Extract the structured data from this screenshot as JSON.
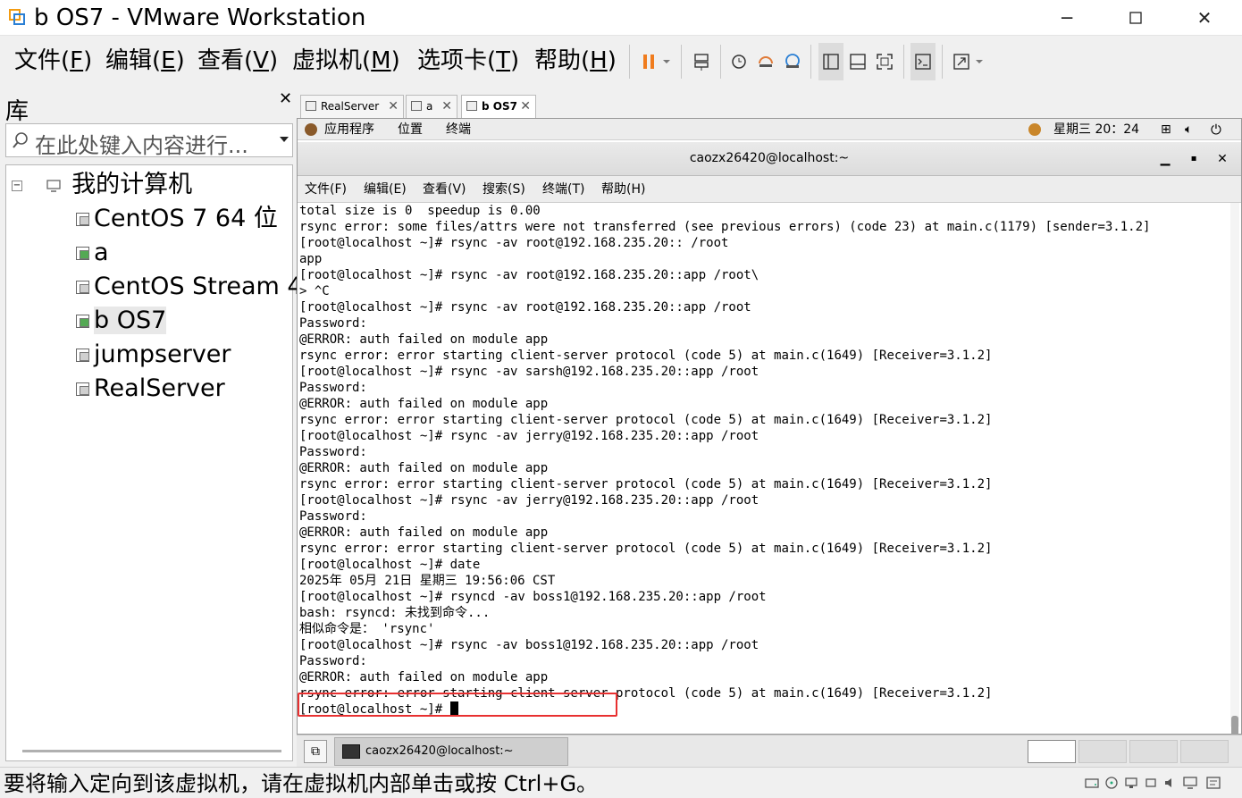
{
  "window": {
    "title": "b OS7 - VMware Workstation"
  },
  "menu": {
    "file": "文件(",
    "file_key": "F",
    "file_end": ")",
    "edit": "编辑(",
    "edit_key": "E",
    "edit_end": ")",
    "view": "查看(",
    "view_key": "V",
    "view_end": ")",
    "vm": "虚拟机(",
    "vm_key": "M",
    "vm_end": ")",
    "tabs": "选项卡(",
    "tabs_key": "T",
    "tabs_end": ")",
    "help": "帮助(",
    "help_key": "H",
    "help_end": ")"
  },
  "library": {
    "title": "库",
    "search_placeholder": "在此处键入内容进行...",
    "root": "我的计算机",
    "items": [
      "CentOS 7 64 位",
      "a",
      "CentOS Stream 4",
      "b OS7",
      "jumpserver",
      "RealServer"
    ]
  },
  "tabs": [
    {
      "label": "RealServer"
    },
    {
      "label": "a"
    },
    {
      "label": "b OS7"
    }
  ],
  "gnome": {
    "applications": "应用程序",
    "places": "位置",
    "terminal": "终端",
    "clock": "星期三 20：24"
  },
  "terminal": {
    "title": "caozx26420@localhost:~",
    "menu": [
      "文件(F)",
      "编辑(E)",
      "查看(V)",
      "搜索(S)",
      "终端(T)",
      "帮助(H)"
    ],
    "lines": [
      "total size is 0  speedup is 0.00",
      "rsync error: some files/attrs were not transferred (see previous errors) (code 23) at main.c(1179) [sender=3.1.2]",
      "[root@localhost ~]# rsync -av root@192.168.235.20:: /root",
      "app",
      "[root@localhost ~]# rsync -av root@192.168.235.20::app /root\\",
      "> ^C",
      "[root@localhost ~]# rsync -av root@192.168.235.20::app /root",
      "Password:",
      "@ERROR: auth failed on module app",
      "rsync error: error starting client-server protocol (code 5) at main.c(1649) [Receiver=3.1.2]",
      "[root@localhost ~]# rsync -av sarsh@192.168.235.20::app /root",
      "Password:",
      "@ERROR: auth failed on module app",
      "rsync error: error starting client-server protocol (code 5) at main.c(1649) [Receiver=3.1.2]",
      "[root@localhost ~]# rsync -av jerry@192.168.235.20::app /root",
      "Password:",
      "@ERROR: auth failed on module app",
      "rsync error: error starting client-server protocol (code 5) at main.c(1649) [Receiver=3.1.2]",
      "[root@localhost ~]# rsync -av jerry@192.168.235.20::app /root",
      "Password:",
      "@ERROR: auth failed on module app",
      "rsync error: error starting client-server protocol (code 5) at main.c(1649) [Receiver=3.1.2]",
      "[root@localhost ~]# date",
      "2025年 05月 21日 星期三 19:56:06 CST",
      "[root@localhost ~]# rsyncd -av boss1@192.168.235.20::app /root",
      "bash: rsyncd: 未找到命令...",
      "相似命令是： 'rsync'",
      "[root@localhost ~]# rsync -av boss1@192.168.235.20::app /root",
      "Password:",
      "@ERROR: auth failed on module app",
      "rsync error: error starting client-server protocol (code 5) at main.c(1649) [Receiver=3.1.2]"
    ],
    "prompt": "[root@localhost ~]# "
  },
  "taskbar": {
    "window_label": "caozx26420@localhost:~"
  },
  "status": {
    "text": "要将输入定向到该虚拟机，请在虚拟机内部单击或按 Ctrl+G。"
  }
}
